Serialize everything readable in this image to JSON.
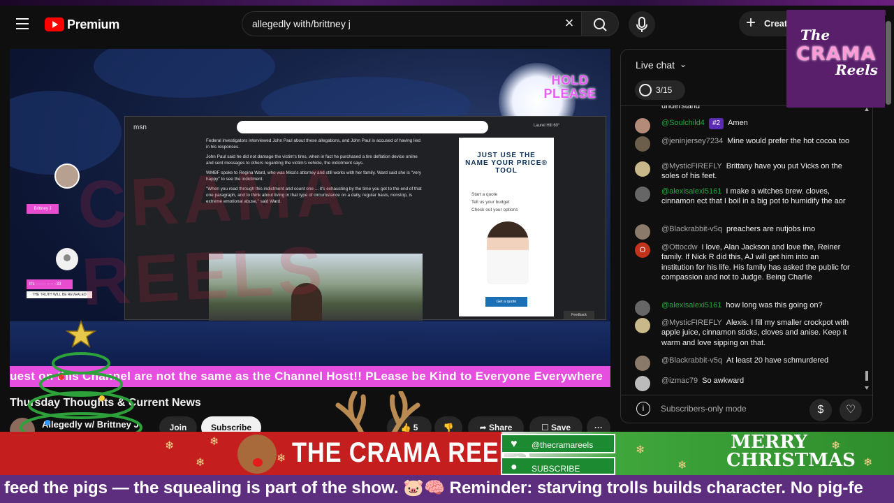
{
  "header": {
    "logo_text": "Premium",
    "search_value": "allegedly with/brittney j",
    "create_label": "Create"
  },
  "video": {
    "overlay_title": "HOLD PLEASE",
    "host_label": "Brittney J",
    "guest_label": "It's ······· ·······33",
    "guest_sub": "THE TRUTH WILL BE REVEALED",
    "ticker": "uest on this Channel are not the same as the Channel Host!! PLease be Kind to Everyone Everywhere",
    "watermark": "CRAMA REELS",
    "screen": {
      "site": "msn",
      "weather": "Laurel Hill  60°",
      "paragraphs": [
        "Federal investigators interviewed John Paul about these allegations, and John Paul is accused of having lied in his responses.",
        "John Paul said he did not damage the victim's tires, when in fact he purchased a tire deflation device online and sent messages to others regarding the victim's vehicle, the indictment says.",
        "WMBF spoke to Regina Ward, who was Mica's attorney and still works with her family. Ward said she is \"very happy\" to see the indictment.",
        "\"When you read through this indictment and count one ... it's exhausting by the time you get to the end of that one paragraph, and to think about living in that type of circumstance on a daily, regular basis, nonstop, is extreme emotional abuse,\" said Ward."
      ],
      "ad_title": "JUST USE THE NAME YOUR PRICE® TOOL",
      "ad_items": [
        "Start a quote",
        "Tell us your budget",
        "Check out your options"
      ],
      "ad_cta": "Get a quote",
      "feedback": "Feedback"
    }
  },
  "below": {
    "title": "Thursday Thoughts & Current News",
    "channel": "Allegedly w/ Brittney J",
    "join": "Join",
    "subscribe": "Subscribe",
    "likes": "5",
    "share": "Share",
    "save": "Save",
    "more": "···"
  },
  "chat": {
    "title": "Live chat",
    "poll": "3/15",
    "cut_line": "understand",
    "messages": [
      {
        "author": "@Soulchild4",
        "badge": "#2",
        "text": "Amen",
        "color": "#b48a78"
      },
      {
        "author": "@jeninjersey7234",
        "text": "Mine would prefer the hot cocoa too",
        "color": "#6b5e4a"
      },
      {
        "author": "@MysticFIREFLY",
        "text": "Brittany have you put Vicks on the soles of his feet.",
        "color": "#c8b88a"
      },
      {
        "author": "@alexisalexi5161",
        "text": "I make a witches brew. cloves, cinnamon ect that I boil in a big pot to humidify the aor",
        "color": "#666666",
        "green": true
      },
      {
        "author": "@Blackrabbit-v5q",
        "text": "preachers are nutjobs imo",
        "color": "#8a7a6a"
      },
      {
        "author": "@Ottocdw",
        "text": "I love, Alan Jackson and love the, Reiner family. If Nick R did this, AJ will get him into an institution for his life. His family has asked the public for compassion and not to Judge. Being Charlie",
        "color": "#c2331b",
        "initial": "O"
      },
      {
        "author": "@alexisalexi5161",
        "text": "how long was this going on?",
        "color": "#666666",
        "green": true
      },
      {
        "author": "@MysticFIREFLY",
        "text": "Alexis. I fill my smaller crockpot with apple juice, cinnamon sticks, cloves and anise. Keep it warm and love sipping on that.",
        "color": "#c8b88a"
      },
      {
        "author": "@Blackrabbit-v5q",
        "text": "At least 20 have schmurdered",
        "color": "#8a7a6a"
      },
      {
        "author": "@izmac79",
        "text": "So awkward",
        "color": "#bbbbbb"
      }
    ],
    "footer_text": "Subscribers-only mode"
  },
  "branding": {
    "logo_the": "The",
    "logo_main": "CRAMA",
    "logo_reels": "Reels",
    "bar_title": "THE CRAMA REELS",
    "social_handle": "@thecramareels",
    "subscribe": "SUBSCRIBE",
    "merry": "MERRY CHRISTMAS",
    "bottom_ticker": "feed the pigs — the squealing is part of the show. 🐷🧠 Reminder: starving trolls builds character. No pig-fe"
  },
  "colors": {
    "accent_pink": "#e64ee0",
    "bottom_bar_purple": "#5d2e7e",
    "youtube_red": "#ff0000"
  }
}
